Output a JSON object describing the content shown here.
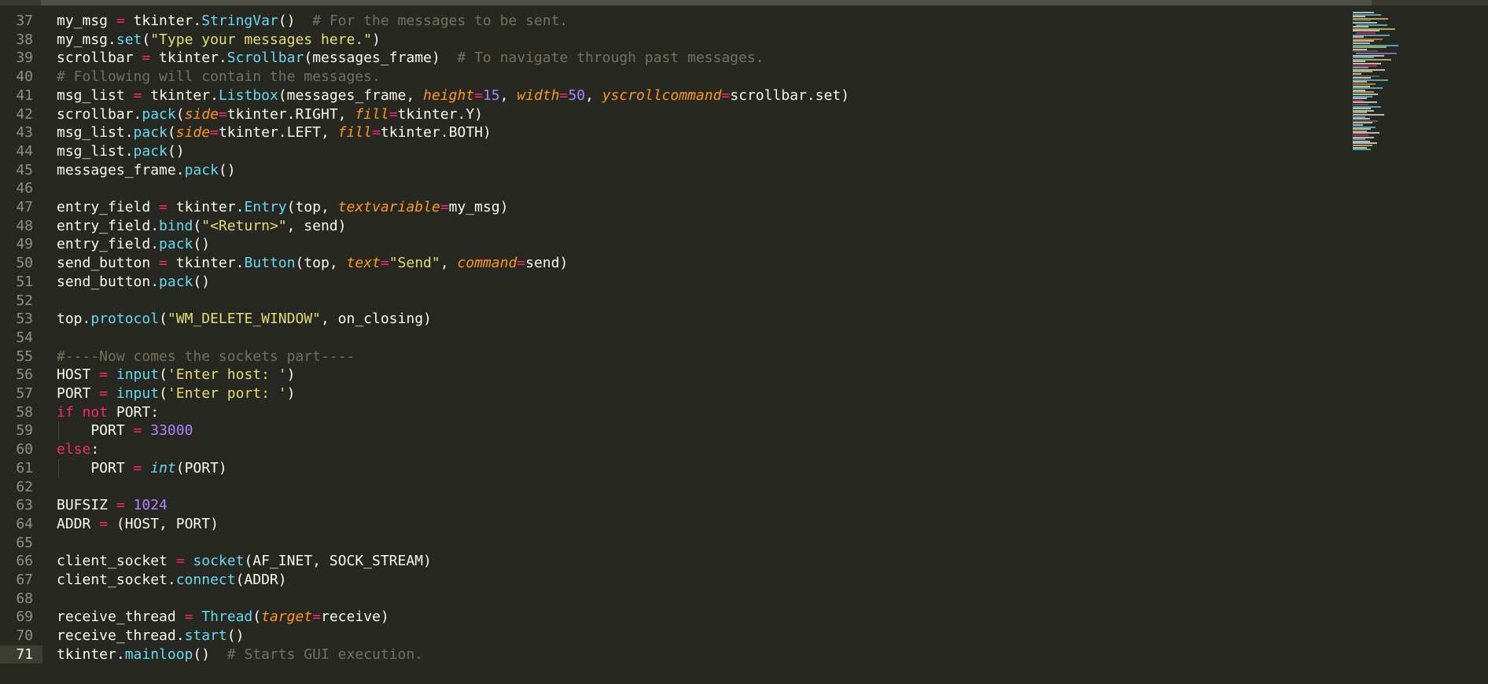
{
  "editor": {
    "theme": {
      "background": "#272822",
      "foreground": "#f8f8f2",
      "keyword": "#f92672",
      "function": "#66d9ef",
      "string": "#e6db74",
      "number": "#ae81ff",
      "comment": "#75715e",
      "argument": "#fd971f",
      "line_number": "#90908a"
    },
    "current_line": 71,
    "lines": [
      {
        "n": 37,
        "tokens": [
          [
            "t",
            "my_msg "
          ],
          [
            "op",
            "="
          ],
          [
            "t",
            " tkinter."
          ],
          [
            "fn",
            "StringVar"
          ],
          [
            "t",
            "()  "
          ],
          [
            "cm",
            "# For the messages to be sent."
          ]
        ]
      },
      {
        "n": 38,
        "tokens": [
          [
            "t",
            "my_msg."
          ],
          [
            "fn",
            "set"
          ],
          [
            "t",
            "("
          ],
          [
            "str",
            "\"Type your messages here.\""
          ],
          [
            "t",
            ")"
          ]
        ]
      },
      {
        "n": 39,
        "tokens": [
          [
            "t",
            "scrollbar "
          ],
          [
            "op",
            "="
          ],
          [
            "t",
            " tkinter."
          ],
          [
            "fn",
            "Scrollbar"
          ],
          [
            "t",
            "(messages_frame)  "
          ],
          [
            "cm",
            "# To navigate through past messages."
          ]
        ]
      },
      {
        "n": 40,
        "tokens": [
          [
            "cm",
            "# Following will contain the messages."
          ]
        ]
      },
      {
        "n": 41,
        "tokens": [
          [
            "t",
            "msg_list "
          ],
          [
            "op",
            "="
          ],
          [
            "t",
            " tkinter."
          ],
          [
            "fn",
            "Listbox"
          ],
          [
            "t",
            "(messages_frame, "
          ],
          [
            "arg",
            "height"
          ],
          [
            "op",
            "="
          ],
          [
            "num",
            "15"
          ],
          [
            "t",
            ", "
          ],
          [
            "arg",
            "width"
          ],
          [
            "op",
            "="
          ],
          [
            "num",
            "50"
          ],
          [
            "t",
            ", "
          ],
          [
            "arg",
            "yscrollcommand"
          ],
          [
            "op",
            "="
          ],
          [
            "t",
            "scrollbar.set)"
          ]
        ]
      },
      {
        "n": 42,
        "tokens": [
          [
            "t",
            "scrollbar."
          ],
          [
            "fn",
            "pack"
          ],
          [
            "t",
            "("
          ],
          [
            "arg",
            "side"
          ],
          [
            "op",
            "="
          ],
          [
            "t",
            "tkinter.RIGHT, "
          ],
          [
            "arg",
            "fill"
          ],
          [
            "op",
            "="
          ],
          [
            "t",
            "tkinter.Y)"
          ]
        ]
      },
      {
        "n": 43,
        "tokens": [
          [
            "t",
            "msg_list."
          ],
          [
            "fn",
            "pack"
          ],
          [
            "t",
            "("
          ],
          [
            "arg",
            "side"
          ],
          [
            "op",
            "="
          ],
          [
            "t",
            "tkinter.LEFT, "
          ],
          [
            "arg",
            "fill"
          ],
          [
            "op",
            "="
          ],
          [
            "t",
            "tkinter.BOTH)"
          ]
        ]
      },
      {
        "n": 44,
        "tokens": [
          [
            "t",
            "msg_list."
          ],
          [
            "fn",
            "pack"
          ],
          [
            "t",
            "()"
          ]
        ]
      },
      {
        "n": 45,
        "tokens": [
          [
            "t",
            "messages_frame."
          ],
          [
            "fn",
            "pack"
          ],
          [
            "t",
            "()"
          ]
        ]
      },
      {
        "n": 46,
        "tokens": []
      },
      {
        "n": 47,
        "tokens": [
          [
            "t",
            "entry_field "
          ],
          [
            "op",
            "="
          ],
          [
            "t",
            " tkinter."
          ],
          [
            "fn",
            "Entry"
          ],
          [
            "t",
            "(top, "
          ],
          [
            "arg",
            "textvariable"
          ],
          [
            "op",
            "="
          ],
          [
            "t",
            "my_msg)"
          ]
        ]
      },
      {
        "n": 48,
        "tokens": [
          [
            "t",
            "entry_field."
          ],
          [
            "fn",
            "bind"
          ],
          [
            "t",
            "("
          ],
          [
            "str",
            "\"<Return>\""
          ],
          [
            "t",
            ", send)"
          ]
        ]
      },
      {
        "n": 49,
        "tokens": [
          [
            "t",
            "entry_field."
          ],
          [
            "fn",
            "pack"
          ],
          [
            "t",
            "()"
          ]
        ]
      },
      {
        "n": 50,
        "tokens": [
          [
            "t",
            "send_button "
          ],
          [
            "op",
            "="
          ],
          [
            "t",
            " tkinter."
          ],
          [
            "fn",
            "Button"
          ],
          [
            "t",
            "(top, "
          ],
          [
            "arg",
            "text"
          ],
          [
            "op",
            "="
          ],
          [
            "str",
            "\"Send\""
          ],
          [
            "t",
            ", "
          ],
          [
            "arg",
            "command"
          ],
          [
            "op",
            "="
          ],
          [
            "t",
            "send)"
          ]
        ]
      },
      {
        "n": 51,
        "tokens": [
          [
            "t",
            "send_button."
          ],
          [
            "fn",
            "pack"
          ],
          [
            "t",
            "()"
          ]
        ]
      },
      {
        "n": 52,
        "tokens": []
      },
      {
        "n": 53,
        "tokens": [
          [
            "t",
            "top."
          ],
          [
            "fn",
            "protocol"
          ],
          [
            "t",
            "("
          ],
          [
            "str",
            "\"WM_DELETE_WINDOW\""
          ],
          [
            "t",
            ", on_closing)"
          ]
        ]
      },
      {
        "n": 54,
        "tokens": []
      },
      {
        "n": 55,
        "tokens": [
          [
            "cm",
            "#----Now comes the sockets part----"
          ]
        ]
      },
      {
        "n": 56,
        "tokens": [
          [
            "t",
            "HOST "
          ],
          [
            "op",
            "="
          ],
          [
            "t",
            " "
          ],
          [
            "fn",
            "input"
          ],
          [
            "t",
            "("
          ],
          [
            "str",
            "'Enter host: '"
          ],
          [
            "t",
            ")"
          ]
        ]
      },
      {
        "n": 57,
        "tokens": [
          [
            "t",
            "PORT "
          ],
          [
            "op",
            "="
          ],
          [
            "t",
            " "
          ],
          [
            "fn",
            "input"
          ],
          [
            "t",
            "("
          ],
          [
            "str",
            "'Enter port: '"
          ],
          [
            "t",
            ")"
          ]
        ]
      },
      {
        "n": 58,
        "tokens": [
          [
            "kw",
            "if"
          ],
          [
            "t",
            " "
          ],
          [
            "kw",
            "not"
          ],
          [
            "t",
            " PORT:"
          ]
        ]
      },
      {
        "n": 59,
        "tokens": [
          [
            "t",
            "    PORT "
          ],
          [
            "op",
            "="
          ],
          [
            "t",
            " "
          ],
          [
            "num",
            "33000"
          ]
        ]
      },
      {
        "n": 60,
        "tokens": [
          [
            "kw",
            "else"
          ],
          [
            "t",
            ":"
          ]
        ]
      },
      {
        "n": 61,
        "tokens": [
          [
            "t",
            "    PORT "
          ],
          [
            "op",
            "="
          ],
          [
            "t",
            " "
          ],
          [
            "blt",
            "int"
          ],
          [
            "t",
            "(PORT)"
          ]
        ]
      },
      {
        "n": 62,
        "tokens": []
      },
      {
        "n": 63,
        "tokens": [
          [
            "t",
            "BUFSIZ "
          ],
          [
            "op",
            "="
          ],
          [
            "t",
            " "
          ],
          [
            "num",
            "1024"
          ]
        ]
      },
      {
        "n": 64,
        "tokens": [
          [
            "t",
            "ADDR "
          ],
          [
            "op",
            "="
          ],
          [
            "t",
            " (HOST, PORT)"
          ]
        ]
      },
      {
        "n": 65,
        "tokens": []
      },
      {
        "n": 66,
        "tokens": [
          [
            "t",
            "client_socket "
          ],
          [
            "op",
            "="
          ],
          [
            "t",
            " "
          ],
          [
            "fn",
            "socket"
          ],
          [
            "t",
            "(AF_INET, SOCK_STREAM)"
          ]
        ]
      },
      {
        "n": 67,
        "tokens": [
          [
            "t",
            "client_socket."
          ],
          [
            "fn",
            "connect"
          ],
          [
            "t",
            "(ADDR)"
          ]
        ]
      },
      {
        "n": 68,
        "tokens": []
      },
      {
        "n": 69,
        "tokens": [
          [
            "t",
            "receive_thread "
          ],
          [
            "op",
            "="
          ],
          [
            "t",
            " "
          ],
          [
            "fn",
            "Thread"
          ],
          [
            "t",
            "("
          ],
          [
            "arg",
            "target"
          ],
          [
            "op",
            "="
          ],
          [
            "t",
            "receive)"
          ]
        ]
      },
      {
        "n": 70,
        "tokens": [
          [
            "t",
            "receive_thread."
          ],
          [
            "fn",
            "start"
          ],
          [
            "t",
            "()"
          ]
        ]
      },
      {
        "n": 71,
        "tokens": [
          [
            "t",
            "tkinter."
          ],
          [
            "fn",
            "mainloop"
          ],
          [
            "t",
            "()  "
          ],
          [
            "cm",
            "# Starts GUI execution."
          ]
        ]
      }
    ]
  },
  "minimap": {
    "colors": [
      "#f8f8f2",
      "#66d9ef",
      "#e6db74",
      "#75715e",
      "#f92672",
      "#fd971f",
      "#ae81ff"
    ]
  }
}
